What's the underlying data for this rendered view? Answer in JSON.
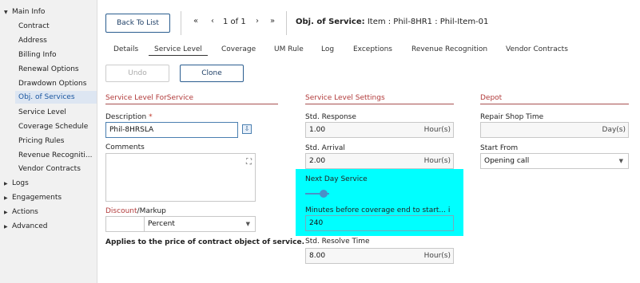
{
  "sidebar": {
    "main_info": "Main Info",
    "items": [
      "Contract",
      "Address",
      "Billing Info",
      "Renewal Options",
      "Drawdown Options",
      "Obj. of Services",
      "Service Level",
      "Coverage Schedule",
      "Pricing Rules",
      "Revenue Recogniti...",
      "Vendor Contracts"
    ],
    "groups": [
      "Logs",
      "Engagements",
      "Actions",
      "Advanced"
    ]
  },
  "toolbar": {
    "back_label": "Back To List",
    "first": "«",
    "prev": "‹",
    "pager": "1 of 1",
    "next": "›",
    "last": "»",
    "record_label": "Obj. of Service:",
    "record_value": " Item : Phil-8HR1 : Phil-Item-01"
  },
  "tabs": [
    "Details",
    "Service Level",
    "Coverage",
    "UM Rule",
    "Log",
    "Exceptions",
    "Revenue Recognition",
    "Vendor Contracts"
  ],
  "actions": {
    "undo": "Undo",
    "clone": "Clone"
  },
  "service_level_for_service": {
    "title": "Service Level ForService",
    "description_label": "Description",
    "required_mark": "*",
    "description_value": "Phil-8HRSLA",
    "comments_label": "Comments",
    "discount_label": "Discount",
    "slash": "/",
    "markup_label": "Markup",
    "discount_value": "",
    "markup_value": "Percent",
    "note": "Applies to the price of contract object of service."
  },
  "service_level_settings": {
    "title": "Service Level Settings",
    "std_response_label": "Std. Response",
    "std_response_value": "1.00",
    "std_response_unit": "Hour(s)",
    "std_arrival_label": "Std. Arrival",
    "std_arrival_value": "2.00",
    "std_arrival_unit": "Hour(s)",
    "next_day_label": "Next Day Service",
    "next_day_enabled": true,
    "minutes_label": "Minutes before coverage end to start...",
    "info_mark": "i",
    "minutes_value": "240",
    "std_resolve_label": "Std. Resolve Time",
    "std_resolve_value": "8.00",
    "std_resolve_unit": "Hour(s)"
  },
  "depot": {
    "title": "Depot",
    "repair_label": "Repair Shop Time",
    "repair_value": "",
    "repair_unit": "Day(s)",
    "start_from_label": "Start From",
    "start_from_value": "Opening call"
  },
  "colors": {
    "accent": "#2a5d8f",
    "section": "#b13a3a",
    "highlight": "#00ffff",
    "toggle": "#4a90c8"
  }
}
